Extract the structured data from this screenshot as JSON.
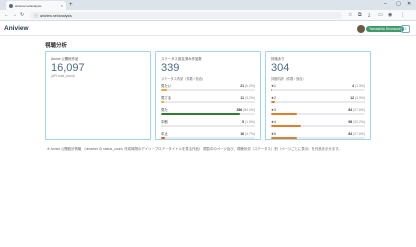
{
  "browser": {
    "tab_title": "aniview.net/analysis",
    "new_tab_label": "+",
    "url": "aniview.net/analysis",
    "min": "–",
    "max": "▢",
    "close": "✕"
  },
  "app": {
    "brand": "Aniview",
    "username": "Yamashita Shunsuke",
    "menu_icon": "≡"
  },
  "page": {
    "title": "視聴分析",
    "footnote": "※ Annict 公開統計情報 （dmarket の status_count, 作成時間のデイリ－ブロア－タイトルを見る作品） 閲覧中のページ及び、視聴状況（ステータス）別（ページごとに表示）を作品を示せます。"
  },
  "cards": {
    "total": {
      "label": "Annict 公開総作品",
      "value": "16,097",
      "note": "(API total_count)"
    },
    "status": {
      "label": "ステータス設定済み作品数",
      "value": "339",
      "dist_label": "ステータス内訳（件数 / 割合）",
      "rows": [
        {
          "label": "見たい",
          "count": "21",
          "pct": "(6.2%)",
          "ratio": 0.062,
          "color": "#f6a623"
        },
        {
          "label": "見てる",
          "count": "11",
          "pct": "(3.2%)",
          "ratio": 0.032,
          "color": "#f6a623"
        },
        {
          "label": "見た",
          "count": "286",
          "pct": "(84.4%)",
          "ratio": 0.844,
          "color": "#2e7d32"
        },
        {
          "label": "中断",
          "count": "5",
          "pct": "(1.5%)",
          "ratio": 0.015,
          "color": "#c9cdd2"
        },
        {
          "label": "中止",
          "count": "16",
          "pct": "(4.7%)",
          "ratio": 0.047,
          "color": "#e05a2b"
        }
      ]
    },
    "rating": {
      "label": "評価あり",
      "value": "304",
      "dist_label": "評価内訳（件数 / 割合）",
      "rows": [
        {
          "label": "★1",
          "count": "4",
          "pct": "(1.3%)",
          "ratio": 0.013,
          "color": "#e57c2b"
        },
        {
          "label": "★2",
          "count": "12",
          "pct": "(3.9%)",
          "ratio": 0.039,
          "color": "#e57c2b"
        },
        {
          "label": "★3",
          "count": "84",
          "pct": "(27.6%)",
          "ratio": 0.276,
          "color": "#e57c2b"
        },
        {
          "label": "★4",
          "count": "98",
          "pct": "(32.2%)",
          "ratio": 0.322,
          "color": "#e57c2b"
        },
        {
          "label": "★5",
          "count": "84",
          "pct": "(27.6%)",
          "ratio": 0.276,
          "color": "#e57c2b"
        }
      ]
    }
  }
}
